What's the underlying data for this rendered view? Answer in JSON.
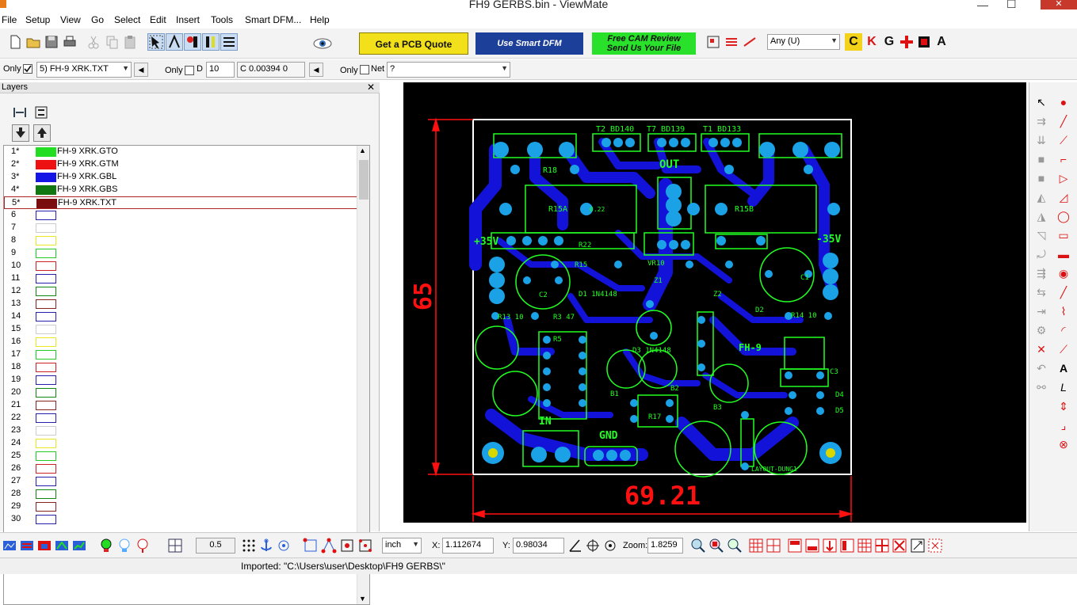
{
  "window": {
    "title": "FH9 GERBS.bin - ViewMate"
  },
  "menu": [
    "File",
    "Setup",
    "View",
    "Go",
    "Select",
    "Edit",
    "Insert",
    "Tools",
    "Smart DFM...",
    "Help"
  ],
  "ads": {
    "pcb_quote": "Get a PCB Quote",
    "smart_dfm": "Use Smart DFM",
    "cam_review_line1": "Free CAM Review",
    "cam_review_line2": "Send Us Your File"
  },
  "toolbar1": {
    "select_type": "Any   (U)",
    "letter_icons": [
      "C",
      "K",
      "G",
      "",
      "A"
    ]
  },
  "toolbar2": {
    "only1_label": "Only",
    "layer_select": "5) FH-9 XRK.TXT",
    "only2_label": "Only",
    "d_label": "D",
    "d_value": "10",
    "c_value": "C 0.00394   0",
    "only3_label": "Only",
    "net_label": "Net",
    "net_value": "?"
  },
  "layers": {
    "title": "Layers",
    "rows": [
      {
        "num": "1*",
        "name": "FH-9 XRK.GTO",
        "color": "#22dd22",
        "filled": true
      },
      {
        "num": "2*",
        "name": "FH-9 XRK.GTM",
        "color": "#ee1111",
        "filled": true
      },
      {
        "num": "3*",
        "name": "FH-9 XRK.GBL",
        "color": "#1515e6",
        "filled": true
      },
      {
        "num": "4*",
        "name": "FH-9 XRK.GBS",
        "color": "#117711",
        "filled": true
      },
      {
        "num": "5*",
        "name": "FH-9 XRK.TXT",
        "color": "#7a0d0d",
        "filled": true,
        "selected": true
      },
      {
        "num": "6",
        "name": "",
        "color": "#2222aa",
        "filled": false
      },
      {
        "num": "7",
        "name": "",
        "color": "#cccccc",
        "filled": false
      },
      {
        "num": "8",
        "name": "",
        "color": "#e8e822",
        "filled": false
      },
      {
        "num": "9",
        "name": "",
        "color": "#22cc22",
        "filled": false
      },
      {
        "num": "10",
        "name": "",
        "color": "#cc2222",
        "filled": false
      },
      {
        "num": "11",
        "name": "",
        "color": "#2222aa",
        "filled": false
      },
      {
        "num": "12",
        "name": "",
        "color": "#118811",
        "filled": false
      },
      {
        "num": "13",
        "name": "",
        "color": "#882222",
        "filled": false
      },
      {
        "num": "14",
        "name": "",
        "color": "#2222aa",
        "filled": false
      },
      {
        "num": "15",
        "name": "",
        "color": "#cccccc",
        "filled": false
      },
      {
        "num": "16",
        "name": "",
        "color": "#e8e822",
        "filled": false
      },
      {
        "num": "17",
        "name": "",
        "color": "#22cc22",
        "filled": false
      },
      {
        "num": "18",
        "name": "",
        "color": "#cc2222",
        "filled": false
      },
      {
        "num": "19",
        "name": "",
        "color": "#2222aa",
        "filled": false
      },
      {
        "num": "20",
        "name": "",
        "color": "#118811",
        "filled": false
      },
      {
        "num": "21",
        "name": "",
        "color": "#882222",
        "filled": false
      },
      {
        "num": "22",
        "name": "",
        "color": "#2222aa",
        "filled": false
      },
      {
        "num": "23",
        "name": "",
        "color": "#cccccc",
        "filled": false
      },
      {
        "num": "24",
        "name": "",
        "color": "#e8e822",
        "filled": false
      },
      {
        "num": "25",
        "name": "",
        "color": "#22cc22",
        "filled": false
      },
      {
        "num": "26",
        "name": "",
        "color": "#cc2222",
        "filled": false
      },
      {
        "num": "27",
        "name": "",
        "color": "#2222aa",
        "filled": false
      },
      {
        "num": "28",
        "name": "",
        "color": "#118811",
        "filled": false
      },
      {
        "num": "29",
        "name": "",
        "color": "#882222",
        "filled": false
      },
      {
        "num": "30",
        "name": "",
        "color": "#2222aa",
        "filled": false
      }
    ]
  },
  "pcb": {
    "dim_height": "65",
    "dim_width": "69.21",
    "silk_labels": {
      "t2": "T2  BD140",
      "t7": "T7  BD139",
      "t1": "T1  BD133",
      "out": "OUT",
      "plus35": "+35V",
      "minus35": "-35V",
      "in": "IN",
      "gnd": "GND",
      "fh9": "FH-9",
      "layout": "LAYOUT-DUNG1",
      "r18": "R18",
      "r15a": "R15A",
      "r15b": "R15B",
      "r22": "R22",
      "q22": "0.22",
      "r15": "R15",
      "d1": "D1  1N4148",
      "r13": "R13  10",
      "r14": "R14  10",
      "r3": "R3  47",
      "r5": "R5",
      "z1": "Z1",
      "z2": "Z2",
      "d2": "D2",
      "d3": "D3  1N4148",
      "c3": "C3",
      "d4": "D4",
      "d5": "D5",
      "c1": "C1",
      "c2": "C2",
      "r17": "R17",
      "b1": "B1",
      "b2": "B2",
      "b3": "B3",
      "vr10": "VR10"
    }
  },
  "bottom": {
    "value_05": "0.5",
    "unit": "inch",
    "x_label": "X:",
    "x_value": "1.112674",
    "y_label": "Y:",
    "y_value": "0.98034",
    "zoom_label": "Zoom:",
    "zoom_value": "1.8259"
  },
  "status": {
    "text": "Imported: \"C:\\Users\\user\\Desktop\\FH9 GERBS\\\""
  },
  "colors": {
    "silk": "#22ff22",
    "copper": "#1212d8",
    "dimension": "#ff1010",
    "background": "#000000",
    "border": "#ffffff",
    "pad": "#1aa1e6"
  }
}
